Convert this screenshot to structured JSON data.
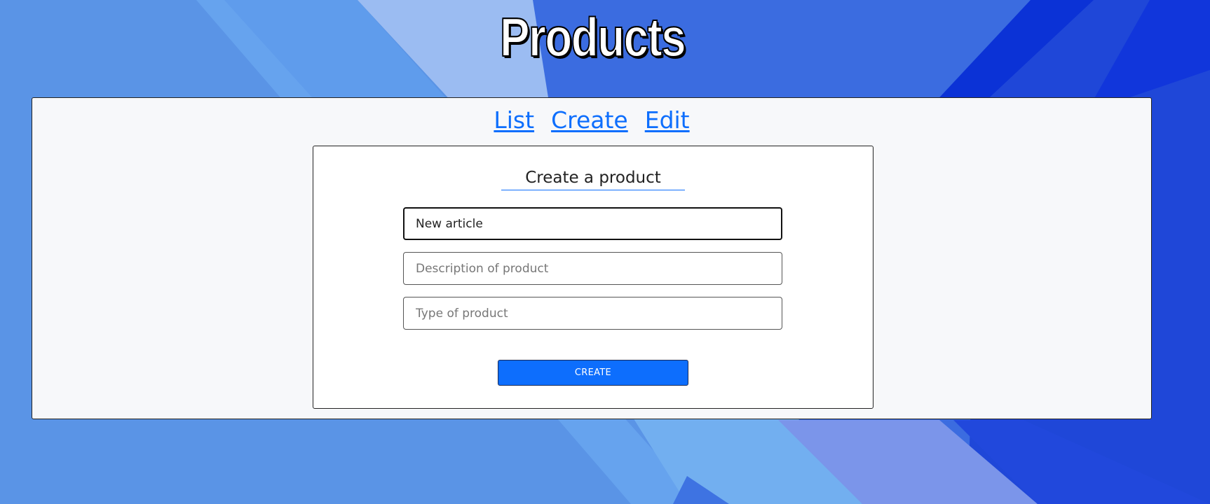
{
  "page": {
    "title": "Products"
  },
  "nav": {
    "list": "List",
    "create": "Create",
    "edit": "Edit"
  },
  "form": {
    "heading": "Create a product",
    "name_value": "New article",
    "description_placeholder": "Description of product",
    "type_placeholder": "Type of product",
    "submit_label": "CREATE"
  },
  "colors": {
    "accent": "#0d6efd",
    "background": "#5a94e6",
    "panel": "#f7f8fa"
  }
}
